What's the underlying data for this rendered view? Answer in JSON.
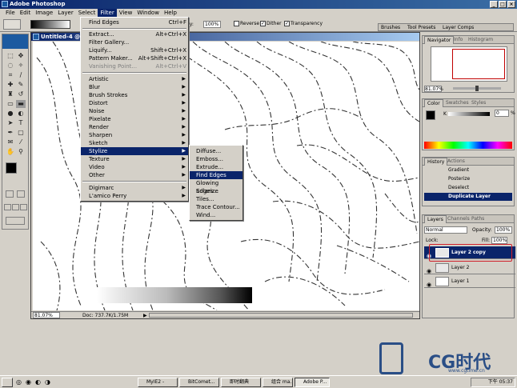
{
  "app": {
    "title": "Adobe Photoshop"
  },
  "menubar": [
    "File",
    "Edit",
    "Image",
    "Layer",
    "Select",
    "Filter",
    "View",
    "Window",
    "Help"
  ],
  "options": {
    "opacity": "100%",
    "reverse": "Reverse",
    "dither": "Dither",
    "transparency": "Transparency"
  },
  "palette_well": [
    "Brushes",
    "Tool Presets",
    "Layer Comps"
  ],
  "document": {
    "title": "Untitled-4 @ 8",
    "zoom": "81.07%",
    "doc_size": "Doc: 737.7K/1.75M"
  },
  "filter_menu": {
    "top": [
      {
        "label": "Find Edges",
        "shortcut": "Ctrl+F"
      },
      {
        "label": "Extract...",
        "shortcut": "Alt+Ctrl+X"
      },
      {
        "label": "Filter Gallery..."
      },
      {
        "label": "Liquify...",
        "shortcut": "Shift+Ctrl+X"
      },
      {
        "label": "Pattern Maker...",
        "shortcut": "Alt+Shift+Ctrl+X"
      },
      {
        "label": "Vanishing Point...",
        "shortcut": "Alt+Ctrl+V",
        "disabled": true
      }
    ],
    "groups": [
      "Artistic",
      "Blur",
      "Brush Strokes",
      "Distort",
      "Noise",
      "Pixelate",
      "Render",
      "Sharpen",
      "Sketch",
      "Stylize",
      "Texture",
      "Video",
      "Other"
    ],
    "plugins": [
      "Digimarc",
      "L'amico Perry"
    ]
  },
  "stylize_submenu": [
    "Diffuse...",
    "Emboss...",
    "Extrude...",
    "Find Edges",
    "Glowing Edges...",
    "Solarize",
    "Tiles...",
    "Trace Contour...",
    "Wind..."
  ],
  "navigator": {
    "tabs": [
      "Navigator",
      "Info",
      "Histogram"
    ],
    "zoom": "81.07%"
  },
  "color": {
    "tabs": [
      "Color",
      "Swatches",
      "Styles"
    ],
    "k_label": "K",
    "k_value": "0",
    "percent": "%"
  },
  "history": {
    "tabs": [
      "History",
      "Actions"
    ],
    "items": [
      "Gradient",
      "Posterize",
      "Deselect",
      "Duplicate Layer"
    ]
  },
  "layers": {
    "tabs": [
      "Layers",
      "Channels",
      "Paths"
    ],
    "blend_mode": "Normal",
    "opacity_label": "Opacity:",
    "opacity": "100%",
    "lock_label": "Lock:",
    "fill_label": "Fill:",
    "fill": "100%",
    "items": [
      "Layer 2 copy",
      "Layer 2",
      "Layer 1"
    ]
  },
  "watermark": {
    "brand": "CG时代",
    "url": "www.cgtime.cn"
  },
  "taskbar": {
    "tasks": [
      "MyIE2 -",
      "BitComet...",
      "即时翻典",
      "组合 ma...",
      "Adobe P..."
    ],
    "time": "下午 05:37"
  },
  "colors": {
    "title_blue": "#0a246a",
    "highlight": "#0a246a",
    "selected_layer": "#0a246a",
    "red_box": "#d0202a"
  }
}
